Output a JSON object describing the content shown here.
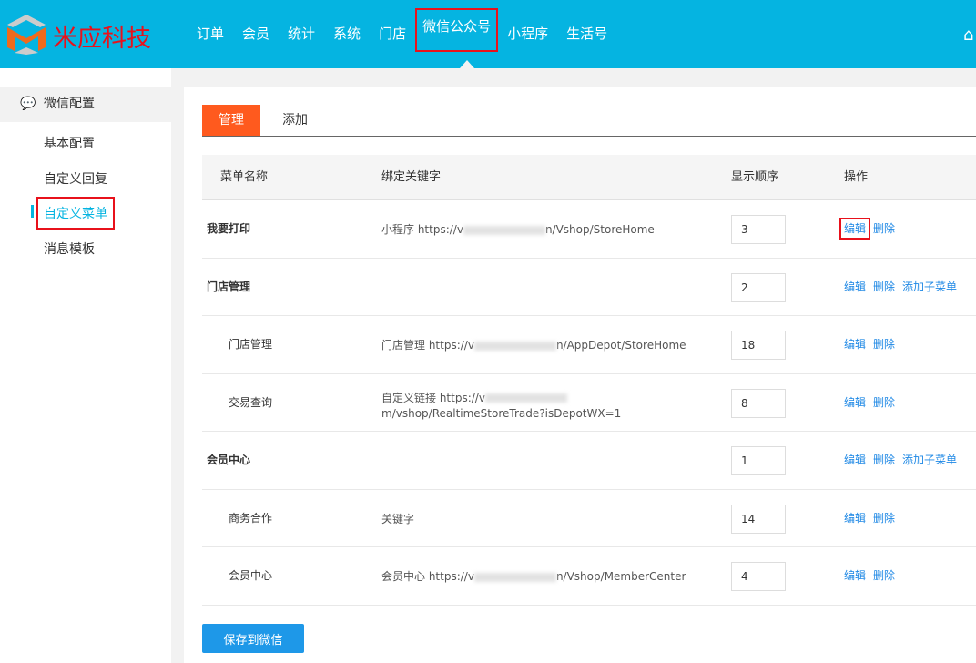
{
  "header": {
    "brand": "米应科技",
    "nav": [
      "订单",
      "会员",
      "统计",
      "系统",
      "门店",
      "微信公众号",
      "小程序",
      "生活号"
    ],
    "active_nav": "微信公众号",
    "home_icon": "home-icon",
    "color": "#05b4e1"
  },
  "sidebar": {
    "group": "微信配置",
    "items": [
      "基本配置",
      "自定义回复",
      "自定义菜单",
      "消息模板"
    ],
    "active": "自定义菜单"
  },
  "tabs": [
    "管理",
    "添加"
  ],
  "table": {
    "headers": [
      "菜单名称",
      "绑定关键字",
      "显示顺序",
      "操作"
    ],
    "rows": [
      {
        "name": "我要打印",
        "level": 1,
        "kw_prefix": "小程序 https://v",
        "kw_suffix": "n/Vshop/StoreHome",
        "order": "3",
        "ops": [
          "编辑",
          "删除"
        ]
      },
      {
        "name": "门店管理",
        "level": 1,
        "kw_prefix": "",
        "kw_suffix": "",
        "order": "2",
        "ops": [
          "编辑",
          "删除",
          "添加子菜单"
        ]
      },
      {
        "name": "门店管理",
        "level": 2,
        "kw_prefix": "门店管理 https://v",
        "kw_suffix": "n/AppDepot/StoreHome",
        "order": "18",
        "ops": [
          "编辑",
          "删除"
        ]
      },
      {
        "name": "交易查询",
        "level": 2,
        "kw_prefix": "自定义链接 https://v",
        "kw_suffix": "m/vshop/RealtimeStoreTrade?isDepotWX=1",
        "order": "8",
        "ops": [
          "编辑",
          "删除"
        ]
      },
      {
        "name": "会员中心",
        "level": 1,
        "kw_prefix": "",
        "kw_suffix": "",
        "order": "1",
        "ops": [
          "编辑",
          "删除",
          "添加子菜单"
        ]
      },
      {
        "name": "商务合作",
        "level": 2,
        "kw_prefix": "关键字",
        "kw_suffix": "",
        "order": "14",
        "ops": [
          "编辑",
          "删除"
        ]
      },
      {
        "name": "会员中心",
        "level": 2,
        "kw_prefix": "会员中心 https://v",
        "kw_suffix": "n/Vshop/MemberCenter",
        "order": "4",
        "ops": [
          "编辑",
          "删除"
        ]
      }
    ]
  },
  "save_label": "保存到微信"
}
